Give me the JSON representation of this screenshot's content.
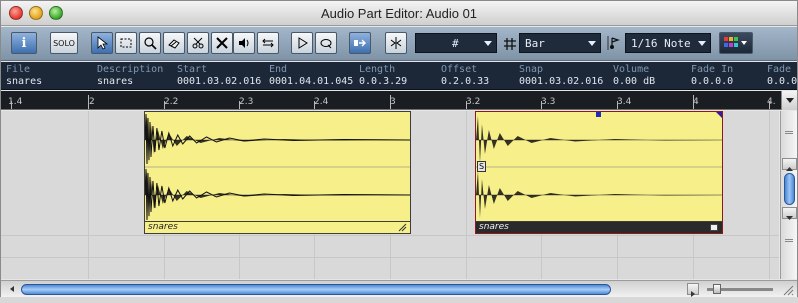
{
  "window": {
    "title": "Audio Part Editor: Audio 01"
  },
  "toolbar": {
    "info_label": "i",
    "solo_label": "SOLO",
    "snap_combo": "#",
    "quantize_type": "Bar",
    "quantize_value": "1/16 Note",
    "snap_icon_label": "⋉"
  },
  "infoline": {
    "columns": [
      {
        "header": "File",
        "value": "snares"
      },
      {
        "header": "Description",
        "value": "snares"
      },
      {
        "header": "Start",
        "value": "0001.03.02.016"
      },
      {
        "header": "End",
        "value": "0001.04.01.045"
      },
      {
        "header": "Length",
        "value": "0.0.3.29"
      },
      {
        "header": "Offset",
        "value": "0.2.0.33"
      },
      {
        "header": "Snap",
        "value": "0001.03.02.016"
      },
      {
        "header": "Volume",
        "value": "0.00 dB"
      },
      {
        "header": "Fade In",
        "value": "0.0.0.0"
      },
      {
        "header": "Fade",
        "value": "0.0.0"
      }
    ]
  },
  "ruler": {
    "labels": [
      "1.4",
      "2",
      "2.2",
      "2.3",
      "2.4",
      "3",
      "3.2",
      "3.3",
      "3.4",
      "4",
      "4."
    ]
  },
  "events": [
    {
      "name": "snares",
      "selected": false
    },
    {
      "name": "snares",
      "selected": true,
      "snap_label": "S"
    }
  ],
  "colors": {
    "event_fill": "#f7ef8a",
    "accent_blue": "#3e6fb0",
    "infoline_bg": "#1c2837"
  }
}
